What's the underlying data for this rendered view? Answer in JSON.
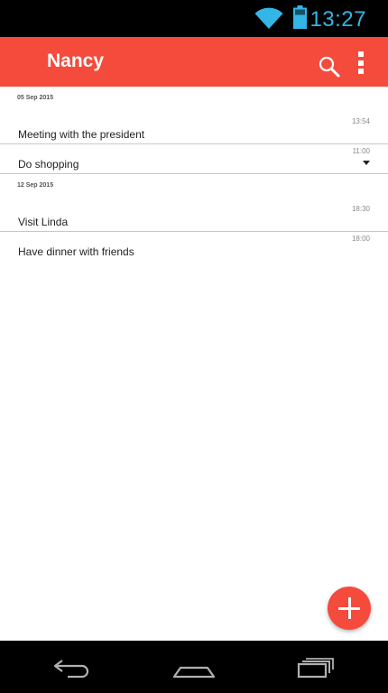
{
  "status_bar": {
    "time": "13:27",
    "icon_color": "#33b5e5"
  },
  "app_bar": {
    "title": "Nancy",
    "background": "#f44b3c",
    "search_icon": "search-icon",
    "overflow_icon": "more-vert-icon"
  },
  "sections": [
    {
      "date": "05 Sep 2015",
      "items": [
        {
          "time": "13:54",
          "title": "Meeting with the president"
        },
        {
          "time": "11:00",
          "title": "Do shopping",
          "expand_icon": "caret-down-icon"
        }
      ]
    },
    {
      "date": "12 Sep 2015",
      "items": [
        {
          "time": "18:30",
          "title": "Visit Linda"
        },
        {
          "time": "18:00",
          "title": "Have dinner with friends"
        }
      ]
    }
  ],
  "fab": {
    "icon": "add-icon",
    "color": "#f44b3c"
  },
  "nav_bar": {
    "back_icon": "back-icon",
    "home_icon": "home-icon",
    "recent_icon": "recent-apps-icon"
  }
}
